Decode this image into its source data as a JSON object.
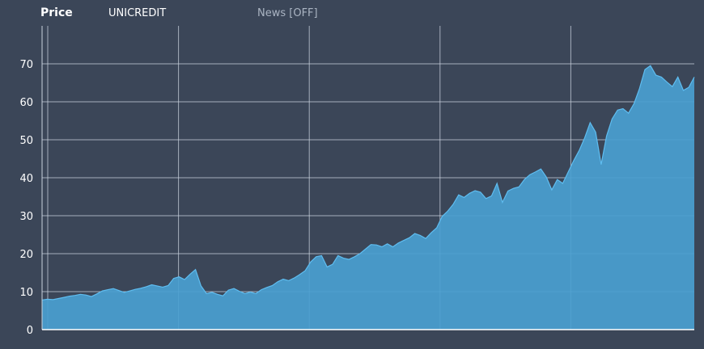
{
  "header": {
    "tab_label": "Price",
    "symbol": "UNICREDIT",
    "news_toggle": "News [OFF]"
  },
  "colors": {
    "background": "#3b4658",
    "area_fill": "#4a9fd0",
    "area_line": "#5fbdf0",
    "grid": "#c9d2de"
  },
  "chart_data": {
    "type": "area",
    "title": "",
    "xlabel": "",
    "ylabel": "",
    "ylim": [
      0,
      80
    ],
    "yticks": [
      0,
      10,
      20,
      30,
      40,
      50,
      60,
      70
    ],
    "grid": true,
    "series": [
      {
        "values": [
          7.8,
          8.0,
          7.9,
          8.2,
          8.5,
          8.8,
          9.0,
          9.3,
          9.1,
          8.7,
          9.4,
          10.2,
          10.5,
          10.8,
          10.3,
          9.8,
          10.2,
          10.6,
          10.9,
          11.3,
          11.8,
          11.5,
          11.2,
          11.6,
          13.5,
          13.9,
          13.2,
          14.6,
          15.8,
          11.5,
          9.5,
          9.8,
          9.3,
          8.9,
          10.4,
          10.8,
          10.1,
          9.5,
          9.9,
          9.5,
          10.5,
          11.1,
          11.6,
          12.6,
          13.3,
          12.9,
          13.6,
          14.5,
          15.5,
          17.8,
          19.2,
          19.5,
          16.5,
          17.2,
          19.5,
          18.8,
          18.5,
          19.2,
          20.0,
          21.2,
          22.4,
          22.3,
          21.8,
          22.6,
          21.8,
          22.8,
          23.5,
          24.2,
          25.3,
          24.8,
          24.0,
          25.5,
          26.8,
          29.8,
          31.2,
          33.0,
          35.5,
          34.8,
          35.9,
          36.6,
          36.2,
          34.5,
          35.2,
          38.5,
          33.5,
          36.5,
          37.2,
          37.6,
          39.5,
          40.8,
          41.5,
          42.3,
          40.2,
          36.8,
          39.5,
          38.5,
          41.5,
          44.5,
          47.2,
          50.5,
          54.5,
          52.0,
          43.5,
          51.0,
          55.5,
          57.8,
          58.2,
          57.0,
          59.5,
          63.5,
          68.5,
          69.5,
          67.0,
          66.5,
          65.2,
          64.0,
          66.5,
          63.0,
          63.8,
          66.5
        ]
      }
    ]
  }
}
